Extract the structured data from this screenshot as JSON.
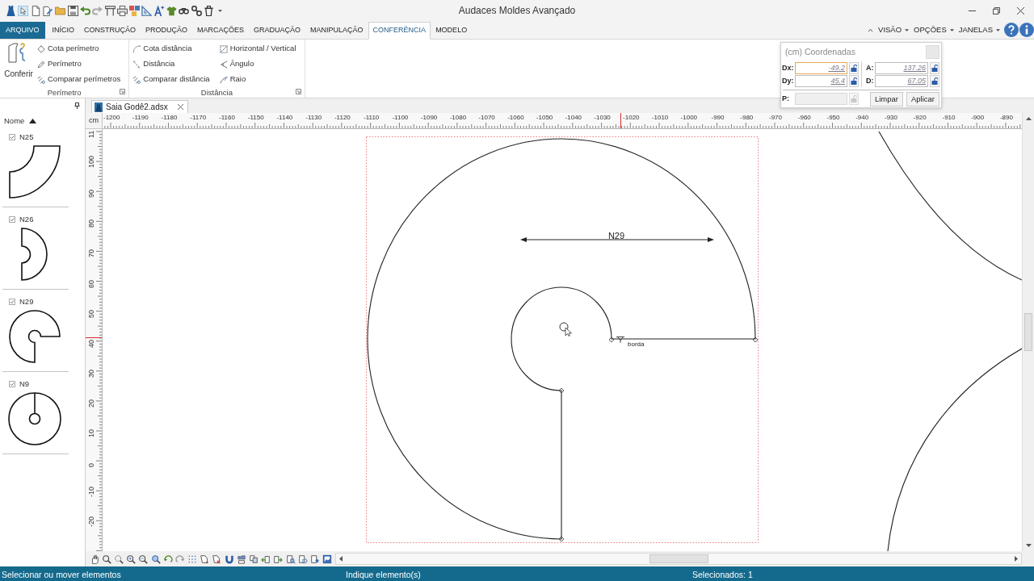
{
  "window": {
    "title": "Audaces Moldes Avançado"
  },
  "tabs": [
    {
      "label": "ARQUIVO",
      "kind": "file",
      "selected": false
    },
    {
      "label": "INÍCIO",
      "kind": "tab",
      "selected": false
    },
    {
      "label": "CONSTRUÇÃO",
      "kind": "tab",
      "selected": false
    },
    {
      "label": "PRODUÇÃO",
      "kind": "tab",
      "selected": false
    },
    {
      "label": "MARCAÇÕES",
      "kind": "tab",
      "selected": false
    },
    {
      "label": "GRADUAÇÃO",
      "kind": "tab",
      "selected": false
    },
    {
      "label": "MANIPULAÇÃO",
      "kind": "tab",
      "selected": false
    },
    {
      "label": "CONFERÊNCIA",
      "kind": "tab",
      "selected": true
    },
    {
      "label": "MODELO",
      "kind": "tab",
      "selected": false
    }
  ],
  "menus": [
    {
      "label": "VISÃO"
    },
    {
      "label": "OPÇÕES"
    },
    {
      "label": "JANELAS"
    }
  ],
  "ribbon": {
    "groups": [
      {
        "label": "Perímetro",
        "items": [
          {
            "label": "Conferir",
            "kind": "large"
          },
          {
            "label": "Cota perímetro",
            "kind": "small"
          },
          {
            "label": "Perímetro",
            "kind": "small"
          },
          {
            "label": "Comparar perímetros",
            "kind": "small"
          }
        ]
      },
      {
        "label": "Distância",
        "items": [
          {
            "label": "Cota distância",
            "kind": "small"
          },
          {
            "label": "Distância",
            "kind": "small"
          },
          {
            "label": "Comparar distância",
            "kind": "small"
          },
          {
            "label": "Horizontal / Vertical",
            "kind": "small"
          },
          {
            "label": "Ângulo",
            "kind": "small"
          },
          {
            "label": "Raio",
            "kind": "small"
          }
        ]
      }
    ]
  },
  "coordinates_panel": {
    "title": "(cm) Coordenadas",
    "fields": [
      {
        "label": "Dx:",
        "value": "-49.2",
        "focused": true
      },
      {
        "label": "A:",
        "value": "137.26",
        "focused": false
      },
      {
        "label": "Dy:",
        "value": "45.4",
        "focused": false
      },
      {
        "label": "D:",
        "value": "67.05",
        "focused": false
      }
    ],
    "p_field": {
      "label": "P:",
      "disabled": true
    },
    "buttons": [
      "Limpar",
      "Aplicar"
    ]
  },
  "pieces_panel": {
    "sort_label": "Nome",
    "items": [
      {
        "name": "N25",
        "checked": true
      },
      {
        "name": "N26",
        "checked": true
      },
      {
        "name": "N29",
        "checked": true
      },
      {
        "name": "N9",
        "checked": true
      }
    ]
  },
  "document_tab": {
    "title": "Saia Godê2.adsx"
  },
  "ruler_top": {
    "unit": "cm",
    "labels": [
      "-1200",
      "-1190",
      "-1180",
      "-1170",
      "-1160",
      "-1150",
      "-1140",
      "-1130",
      "-1120",
      "-1110",
      "-1100",
      "-1090",
      "-1080",
      "-1070",
      "-1060",
      "-1050",
      "-1040",
      "-1030",
      "-1020",
      "-1010",
      "-1000",
      "-990",
      "-980",
      "-970",
      "-960",
      "-950",
      "-940",
      "-930",
      "-920",
      "-910",
      "-900",
      "-890"
    ]
  },
  "ruler_left": {
    "labels": [
      "11",
      "100",
      "90",
      "80",
      "70",
      "60",
      "50",
      "40",
      "30",
      "20",
      "10",
      "0",
      "-10",
      "-20"
    ]
  },
  "canvas": {
    "dimension_label": "N29",
    "point_label": "borda"
  },
  "status_bar": [
    "Selecionar ou mover elementos",
    "Indique elemento(s)",
    "Selecionados: 1"
  ]
}
